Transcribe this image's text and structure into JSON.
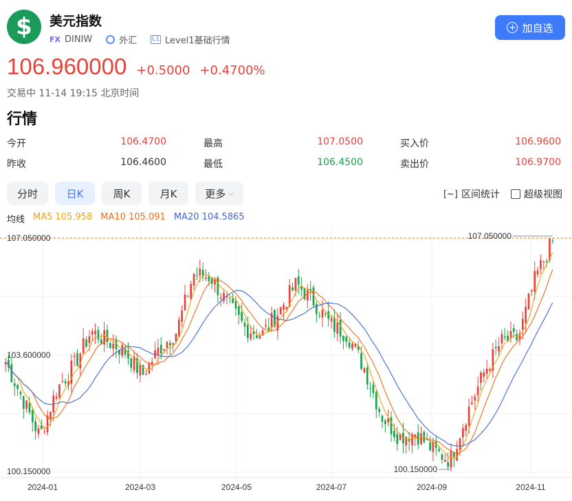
{
  "header": {
    "logo_glyph": "$",
    "title": "美元指数",
    "tag_fx": "FX",
    "code": "DINIW",
    "market": "外汇",
    "level_badge": "L1",
    "level": "Level1基础行情",
    "add_button": "加自选"
  },
  "price": {
    "last": "106.960000",
    "change": "+0.5000",
    "change_pct": "+0.4700%"
  },
  "status": "交易中 11-14 19:15 北京时间",
  "section_title": "行情",
  "quote": {
    "open_label": "今开",
    "open": "106.4700",
    "high_label": "最高",
    "high": "107.0500",
    "bid_label": "买入价",
    "bid": "106.9600",
    "prev_close_label": "昨收",
    "prev_close": "106.4600",
    "low_label": "最低",
    "low": "106.4500",
    "ask_label": "卖出价",
    "ask": "106.9700"
  },
  "tabs": [
    "分时",
    "日K",
    "周K",
    "月K",
    "更多"
  ],
  "active_tab": 1,
  "tools": {
    "range_stats": "区间统计",
    "super_view": "超级视图"
  },
  "ma": {
    "label": "均线",
    "ma5": "MA5 105.958",
    "ma10": "MA10 105.091",
    "ma20": "MA20 104.5865"
  },
  "colors": {
    "up": "#e8403a",
    "down": "#17a34a",
    "accent": "#3e7bfa",
    "ma5": "#f0a30a",
    "ma10": "#f26b16",
    "ma20": "#3e67d6"
  },
  "chart_data": {
    "type": "candlestick",
    "y_tick_labels": [
      "107.050000",
      "103.600000",
      "100.150000"
    ],
    "ylim": [
      100.15,
      107.05
    ],
    "high_marker": "107.050000",
    "low_marker": "100.150000",
    "x_tick_labels": [
      "2024-01",
      "2024-03",
      "2024-05",
      "2024-07",
      "2024-09",
      "2024-11"
    ],
    "close_path": [
      [
        "2023-12",
        103.4
      ],
      [
        "2024-01",
        102.3
      ],
      [
        "2024-01",
        101.2
      ],
      [
        "2024-01",
        102.6
      ],
      [
        "2024-02",
        103.3
      ],
      [
        "2024-02",
        104.3
      ],
      [
        "2024-02",
        104.0
      ],
      [
        "2024-03",
        103.7
      ],
      [
        "2024-03",
        103.0
      ],
      [
        "2024-03",
        103.8
      ],
      [
        "2024-04",
        104.3
      ],
      [
        "2024-04",
        106.0
      ],
      [
        "2024-04",
        105.9
      ],
      [
        "2024-05",
        105.1
      ],
      [
        "2024-05",
        104.4
      ],
      [
        "2024-06",
        104.2
      ],
      [
        "2024-06",
        104.9
      ],
      [
        "2024-06",
        105.7
      ],
      [
        "2024-07",
        105.2
      ],
      [
        "2024-07",
        104.5
      ],
      [
        "2024-07",
        104.2
      ],
      [
        "2024-08",
        103.2
      ],
      [
        "2024-08",
        101.8
      ],
      [
        "2024-08",
        101.2
      ],
      [
        "2024-09",
        101.3
      ],
      [
        "2024-09",
        100.8
      ],
      [
        "2024-09",
        100.5
      ],
      [
        "2024-10",
        101.9
      ],
      [
        "2024-10",
        103.1
      ],
      [
        "2024-10",
        104.0
      ],
      [
        "2024-11",
        104.1
      ],
      [
        "2024-11",
        105.9
      ],
      [
        "2024-11",
        106.96
      ]
    ]
  }
}
